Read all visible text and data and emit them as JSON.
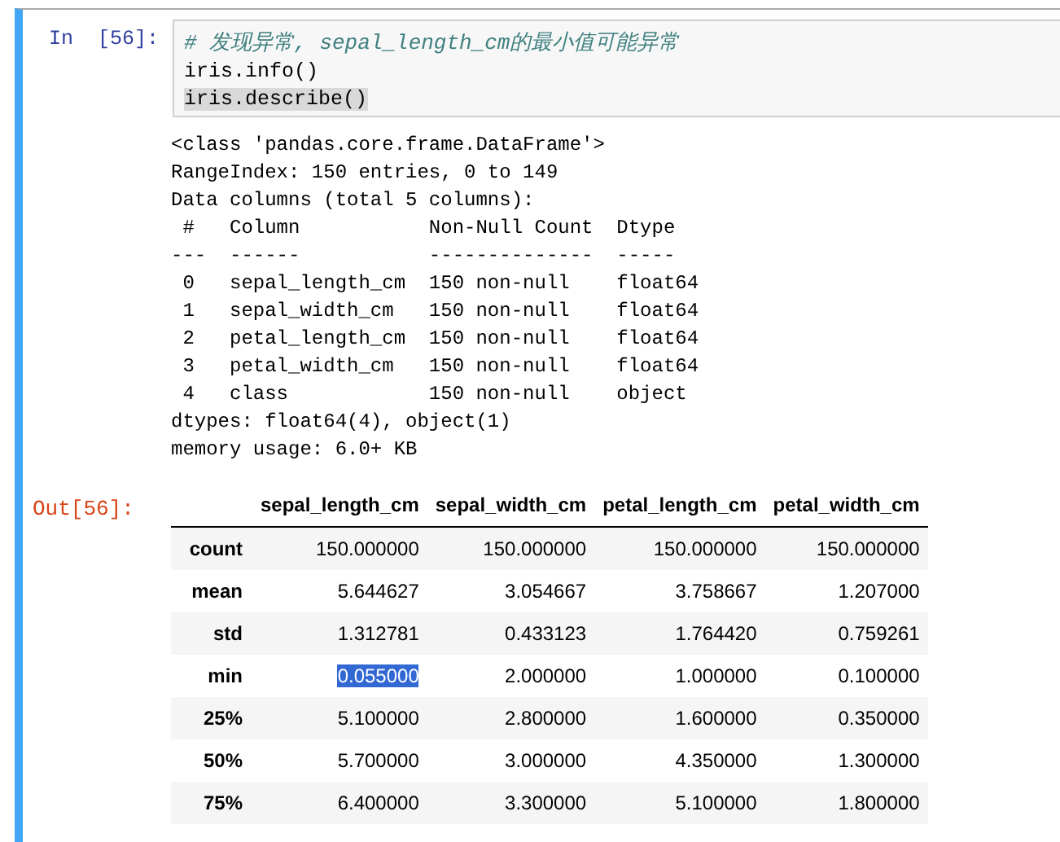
{
  "cell": {
    "prompt_in": "In  [56]:",
    "code": [
      {
        "text": "# 发现异常, sepal_length_cm的最小值可能异常",
        "kind": "comment",
        "highlighted": false
      },
      {
        "text": "iris.info()",
        "kind": "code",
        "highlighted": false
      },
      {
        "text": "iris.describe()",
        "kind": "code",
        "highlighted": true
      }
    ],
    "stream_output": [
      "<class 'pandas.core.frame.DataFrame'>",
      "RangeIndex: 150 entries, 0 to 149",
      "Data columns (total 5 columns):",
      " #   Column           Non-Null Count  Dtype  ",
      "---  ------           --------------  -----  ",
      " 0   sepal_length_cm  150 non-null    float64",
      " 1   sepal_width_cm   150 non-null    float64",
      " 2   petal_length_cm  150 non-null    float64",
      " 3   petal_width_cm   150 non-null    float64",
      " 4   class            150 non-null    object ",
      "dtypes: float64(4), object(1)",
      "memory usage: 6.0+ KB"
    ],
    "prompt_out": "Out[56]:",
    "table": {
      "columns": [
        "sepal_length_cm",
        "sepal_width_cm",
        "petal_length_cm",
        "petal_width_cm"
      ],
      "rows": [
        {
          "label": "count",
          "cells": [
            {
              "text": "150.000000",
              "highlighted": false
            },
            {
              "text": "150.000000",
              "highlighted": false
            },
            {
              "text": "150.000000",
              "highlighted": false
            },
            {
              "text": "150.000000",
              "highlighted": false
            }
          ]
        },
        {
          "label": "mean",
          "cells": [
            {
              "text": "5.644627",
              "highlighted": false
            },
            {
              "text": "3.054667",
              "highlighted": false
            },
            {
              "text": "3.758667",
              "highlighted": false
            },
            {
              "text": "1.207000",
              "highlighted": false
            }
          ]
        },
        {
          "label": "std",
          "cells": [
            {
              "text": "1.312781",
              "highlighted": false
            },
            {
              "text": "0.433123",
              "highlighted": false
            },
            {
              "text": "1.764420",
              "highlighted": false
            },
            {
              "text": "0.759261",
              "highlighted": false
            }
          ]
        },
        {
          "label": "min",
          "cells": [
            {
              "text": "0.055000",
              "highlighted": true
            },
            {
              "text": "2.000000",
              "highlighted": false
            },
            {
              "text": "1.000000",
              "highlighted": false
            },
            {
              "text": "0.100000",
              "highlighted": false
            }
          ]
        },
        {
          "label": "25%",
          "cells": [
            {
              "text": "5.100000",
              "highlighted": false
            },
            {
              "text": "2.800000",
              "highlighted": false
            },
            {
              "text": "1.600000",
              "highlighted": false
            },
            {
              "text": "0.350000",
              "highlighted": false
            }
          ]
        },
        {
          "label": "50%",
          "cells": [
            {
              "text": "5.700000",
              "highlighted": false
            },
            {
              "text": "3.000000",
              "highlighted": false
            },
            {
              "text": "4.350000",
              "highlighted": false
            },
            {
              "text": "1.300000",
              "highlighted": false
            }
          ]
        },
        {
          "label": "75%",
          "cells": [
            {
              "text": "6.400000",
              "highlighted": false
            },
            {
              "text": "3.300000",
              "highlighted": false
            },
            {
              "text": "5.100000",
              "highlighted": false
            },
            {
              "text": "1.800000",
              "highlighted": false
            }
          ]
        }
      ]
    }
  }
}
